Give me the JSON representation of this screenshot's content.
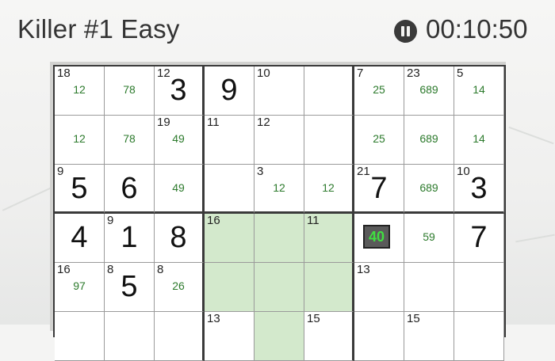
{
  "header": {
    "title": "Killer #1 Easy",
    "timer": "00:10:50"
  },
  "icons": {
    "pause": "pause-icon"
  },
  "colors": {
    "shade": "#d3e9cc",
    "notes": "#2c7a2c",
    "selected_bg": "#5a5a5a",
    "selected_text": "#40e040"
  },
  "board": {
    "rows": [
      [
        {
          "sum": "18",
          "val": "",
          "notes": "12"
        },
        {
          "sum": "",
          "val": "",
          "notes": "78"
        },
        {
          "sum": "12",
          "val": "3",
          "notes": ""
        },
        {
          "sum": "",
          "val": "9",
          "notes": ""
        },
        {
          "sum": "10",
          "val": "",
          "notes": ""
        },
        {
          "sum": "",
          "val": "",
          "notes": ""
        },
        {
          "sum": "7",
          "val": "",
          "notes": "25"
        },
        {
          "sum": "23",
          "val": "",
          "notes": "689"
        },
        {
          "sum": "5",
          "val": "",
          "notes": "14"
        }
      ],
      [
        {
          "sum": "",
          "val": "",
          "notes": "12"
        },
        {
          "sum": "",
          "val": "",
          "notes": "78"
        },
        {
          "sum": "19",
          "val": "",
          "notes": "49"
        },
        {
          "sum": "11",
          "val": "",
          "notes": ""
        },
        {
          "sum": "12",
          "val": "",
          "notes": ""
        },
        {
          "sum": "",
          "val": "",
          "notes": ""
        },
        {
          "sum": "",
          "val": "",
          "notes": "25"
        },
        {
          "sum": "",
          "val": "",
          "notes": "689"
        },
        {
          "sum": "",
          "val": "",
          "notes": "14"
        }
      ],
      [
        {
          "sum": "9",
          "val": "5",
          "notes": ""
        },
        {
          "sum": "",
          "val": "6",
          "notes": ""
        },
        {
          "sum": "",
          "val": "",
          "notes": "49"
        },
        {
          "sum": "",
          "val": "",
          "notes": ""
        },
        {
          "sum": "3",
          "val": "",
          "notes": "12"
        },
        {
          "sum": "",
          "val": "",
          "notes": "12"
        },
        {
          "sum": "21",
          "val": "7",
          "notes": ""
        },
        {
          "sum": "",
          "val": "",
          "notes": "689"
        },
        {
          "sum": "10",
          "val": "3",
          "notes": ""
        }
      ],
      [
        {
          "sum": "",
          "val": "4",
          "notes": ""
        },
        {
          "sum": "9",
          "val": "1",
          "notes": ""
        },
        {
          "sum": "",
          "val": "8",
          "notes": ""
        },
        {
          "sum": "16",
          "val": "",
          "notes": "",
          "shade": true
        },
        {
          "sum": "",
          "val": "",
          "notes": "",
          "shade": true
        },
        {
          "sum": "11",
          "val": "",
          "notes": "",
          "shade": true
        },
        {
          "sum": "",
          "val": "",
          "notes": "",
          "selected": "40"
        },
        {
          "sum": "",
          "val": "",
          "notes": "59"
        },
        {
          "sum": "",
          "val": "7",
          "notes": ""
        }
      ],
      [
        {
          "sum": "16",
          "val": "",
          "notes": "97"
        },
        {
          "sum": "8",
          "val": "5",
          "notes": ""
        },
        {
          "sum": "8",
          "val": "",
          "notes": "26"
        },
        {
          "sum": "",
          "val": "",
          "notes": "",
          "shade": true
        },
        {
          "sum": "",
          "val": "",
          "notes": "",
          "shade": true
        },
        {
          "sum": "",
          "val": "",
          "notes": "",
          "shade": true
        },
        {
          "sum": "13",
          "val": "",
          "notes": ""
        },
        {
          "sum": "",
          "val": "",
          "notes": ""
        },
        {
          "sum": "",
          "val": "",
          "notes": ""
        }
      ],
      [
        {
          "sum": "",
          "val": "",
          "notes": ""
        },
        {
          "sum": "",
          "val": "",
          "notes": ""
        },
        {
          "sum": "",
          "val": "",
          "notes": ""
        },
        {
          "sum": "13",
          "val": "",
          "notes": ""
        },
        {
          "sum": "",
          "val": "",
          "notes": "",
          "shade": true
        },
        {
          "sum": "15",
          "val": "",
          "notes": ""
        },
        {
          "sum": "",
          "val": "",
          "notes": ""
        },
        {
          "sum": "15",
          "val": "",
          "notes": ""
        },
        {
          "sum": "",
          "val": "",
          "notes": ""
        }
      ]
    ]
  }
}
